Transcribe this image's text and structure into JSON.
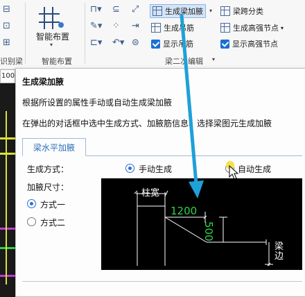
{
  "ribbon": {
    "left_group_label": "智能布置",
    "left_cut_label": "识别梁",
    "left_number": "100",
    "smart_layout_button": "智能布置",
    "generate_haunch": "生成梁加腋",
    "span_classify": "梁跨分类",
    "generate_hanger": "生成吊筋",
    "generate_node": "生成高强节点",
    "show_hanger": "显示吊筋",
    "show_node": "显示高强节点",
    "group_label": "梁二次编辑"
  },
  "tooltip": {
    "title": "生成梁加腋",
    "desc1": "根据所设置的属性手动或自动生成梁加腋",
    "desc2": "在弹出的对话框中选中生成方式、加腋筋信息、选择梁图元生成加腋",
    "tab": "梁水平加腋",
    "method_label": "生成方式：",
    "manual": "手动生成",
    "auto": "自动生成",
    "size_label": "加腋尺寸：",
    "option1": "方式一",
    "option2": "方式二",
    "diagram": {
      "col_width": "柱宽",
      "len": "1200",
      "height": "500",
      "beam_edge": "梁边"
    }
  },
  "colors": {
    "accent": "#2e6fb9",
    "arrow": "#1fa0d8",
    "diagram_green": "#2fd24a"
  }
}
